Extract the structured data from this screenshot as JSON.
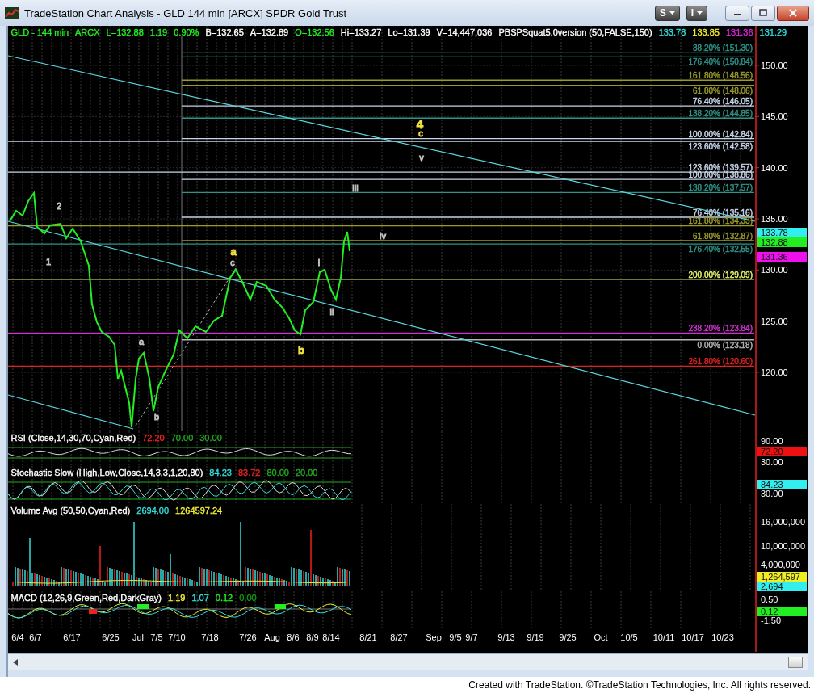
{
  "window": {
    "title": "TradeStation Chart Analysis - GLD 144 min [ARCX] SPDR Gold Trust"
  },
  "toolbar": [
    {
      "label": "S"
    },
    {
      "label": "I"
    }
  ],
  "symbol_bar": {
    "items": [
      {
        "text": "GLD - 144 min",
        "color": "#22ee22"
      },
      {
        "text": "ARCX",
        "color": "#22ee22"
      },
      {
        "text": "L=132.88",
        "color": "#22ee22"
      },
      {
        "text": "1.19",
        "color": "#22ee22"
      },
      {
        "text": "0.90%",
        "color": "#22ee22"
      },
      {
        "text": "B=132.65",
        "color": "#ffffff"
      },
      {
        "text": "A=132.89",
        "color": "#ffffff"
      },
      {
        "text": "O=132.56",
        "color": "#22ee22"
      },
      {
        "text": "Hi=133.27",
        "color": "#ffffff"
      },
      {
        "text": "Lo=131.39",
        "color": "#ffffff"
      },
      {
        "text": "V=14,447,036",
        "color": "#ffffff"
      },
      {
        "text": "PBSPSquat5.0version (50,FALSE,150)",
        "color": "#ffffff"
      },
      {
        "text": "133.78",
        "color": "#33dddd"
      },
      {
        "text": "133.85",
        "color": "#eeee33"
      },
      {
        "text": "131.36",
        "color": "#dd22dd"
      },
      {
        "text": "131.29",
        "color": "#33dddd"
      }
    ]
  },
  "price_chart": {
    "fib_levels": [
      {
        "label": "38.20% (151.30)",
        "color": "#2e9488"
      },
      {
        "label": "176.40% (150.84)",
        "color": "#2e9488"
      },
      {
        "label": "161.80% (148.56)",
        "color": "#9a9a2a"
      },
      {
        "label": "61.80% (148.06)",
        "color": "#9a9a2a"
      },
      {
        "label": "76.40% (146.05)",
        "color": "#c8d4e8"
      },
      {
        "label": "138.20% (144.85)",
        "color": "#2e9488"
      },
      {
        "label": "100.00% (142.84)",
        "color": "#c8d4e8"
      },
      {
        "label": "123.60% (142.58)",
        "color": "#c8d4e8"
      },
      {
        "label": "123.60% (139.57)",
        "color": "#c8d4e8"
      },
      {
        "label": "100.00% (138.86)",
        "color": "#c8d4e8"
      },
      {
        "label": "138.20% (137.57)",
        "color": "#2e9488"
      },
      {
        "label": "76.40% (135.16)",
        "color": "#c8d4e8"
      },
      {
        "label": "161.80% (134.33)",
        "color": "#9a9a2a"
      },
      {
        "label": "61.80% (132.87)",
        "color": "#9a9a2a"
      },
      {
        "label": "176.40% (132.55)",
        "color": "#2e9488"
      },
      {
        "label": "200.00% (129.09)",
        "color": "#e4f466"
      },
      {
        "label": "238.20% (123.84)",
        "color": "#cc33cc"
      },
      {
        "label": "0.00% (123.18)",
        "color": "#b4b4b4"
      },
      {
        "label": "261.80% (120.60)",
        "color": "#dd2222"
      }
    ],
    "wave_labels": [
      {
        "text": "4",
        "color": "#f0e040"
      },
      {
        "text": "c",
        "color": "#f0e040"
      },
      {
        "text": "v",
        "color": "#c0c0c0"
      },
      {
        "text": "iii",
        "color": "#c0c0c0"
      },
      {
        "text": "2",
        "color": "#c0c0c0"
      },
      {
        "text": "iv",
        "color": "#c0c0c0"
      },
      {
        "text": "a",
        "color": "#f0e040"
      },
      {
        "text": "1",
        "color": "#c0c0c0"
      },
      {
        "text": "c",
        "color": "#c0c0c0"
      },
      {
        "text": "i",
        "color": "#c0c0c0"
      },
      {
        "text": "ii",
        "color": "#c0c0c0"
      },
      {
        "text": "a",
        "color": "#c0c0c0"
      },
      {
        "text": "b",
        "color": "#f0e040"
      },
      {
        "text": "b",
        "color": "#c0c0c0"
      }
    ],
    "axis_labels": [
      "150.00",
      "145.00",
      "140.00",
      "135.00",
      "130.00",
      "125.00",
      "120.00"
    ],
    "price_badges": [
      {
        "text": "133.78",
        "color": "#33eeee"
      },
      {
        "text": "132.88",
        "color": "#22ee22"
      },
      {
        "text": "131.36",
        "color": "#ee11ee"
      }
    ]
  },
  "indicators": [
    {
      "kind": "rsi",
      "legend": [
        {
          "text": "RSI (Close,14,30,70,Cyan,Red)",
          "color": "#ffffff"
        },
        {
          "text": "72.20",
          "color": "#ee2222"
        },
        {
          "text": "70.00",
          "color": "#22aa22"
        },
        {
          "text": "30.00",
          "color": "#22aa22"
        }
      ],
      "axis_labels": [
        "90.00",
        "30.00"
      ],
      "badges": [
        {
          "text": "72.20",
          "color": "#ee1111"
        }
      ]
    },
    {
      "kind": "stochastic",
      "legend": [
        {
          "text": "Stochastic Slow (High,Low,Close,14,3,3,1,20,80)",
          "color": "#ffffff"
        },
        {
          "text": "84.23",
          "color": "#33dddd"
        },
        {
          "text": "83.72",
          "color": "#ee2222"
        },
        {
          "text": "80.00",
          "color": "#22aa22"
        },
        {
          "text": "20.00",
          "color": "#22aa22"
        }
      ],
      "axis_labels": [
        "30.00"
      ],
      "badges": [
        {
          "text": "84.23",
          "color": "#33eeee"
        }
      ]
    },
    {
      "kind": "volume",
      "legend": [
        {
          "text": "Volume Avg (50,50,Cyan,Red)",
          "color": "#ffffff"
        },
        {
          "text": "2694.00",
          "color": "#33dddd"
        },
        {
          "text": "1264597.24",
          "color": "#eeee33"
        }
      ],
      "axis_labels": [
        "16,000,000",
        "10,000,000",
        "4,000,000"
      ],
      "badges": [
        {
          "text": "1,264,597",
          "color": "#eeee22"
        },
        {
          "text": "2,694",
          "color": "#33eeee"
        }
      ]
    },
    {
      "kind": "macd",
      "legend": [
        {
          "text": "MACD (12,26,9,Green,Red,DarkGray)",
          "color": "#ffffff"
        },
        {
          "text": "1.19",
          "color": "#eeee33"
        },
        {
          "text": "1.07",
          "color": "#33dddd"
        },
        {
          "text": "0.12",
          "color": "#22ee22"
        },
        {
          "text": "0.00",
          "color": "#119911"
        }
      ],
      "axis_labels": [
        "0.50",
        "-1.50"
      ],
      "badges": [
        {
          "text": "0.12",
          "color": "#22ee22"
        }
      ]
    }
  ],
  "time_axis": [
    "6/4",
    "6/7",
    "6/17",
    "6/25",
    "Jul",
    "7/5",
    "7/10",
    "7/18",
    "7/26",
    "Aug",
    "8/6",
    "8/9",
    "8/14",
    "8/21",
    "8/27",
    "Sep",
    "9/5",
    "9/7",
    "9/13",
    "9/19",
    "9/25",
    "Oct",
    "10/5",
    "10/11",
    "10/17",
    "10/23"
  ],
  "footer": "Created with TradeStation. ©TradeStation Technologies, Inc. All rights reserved."
}
